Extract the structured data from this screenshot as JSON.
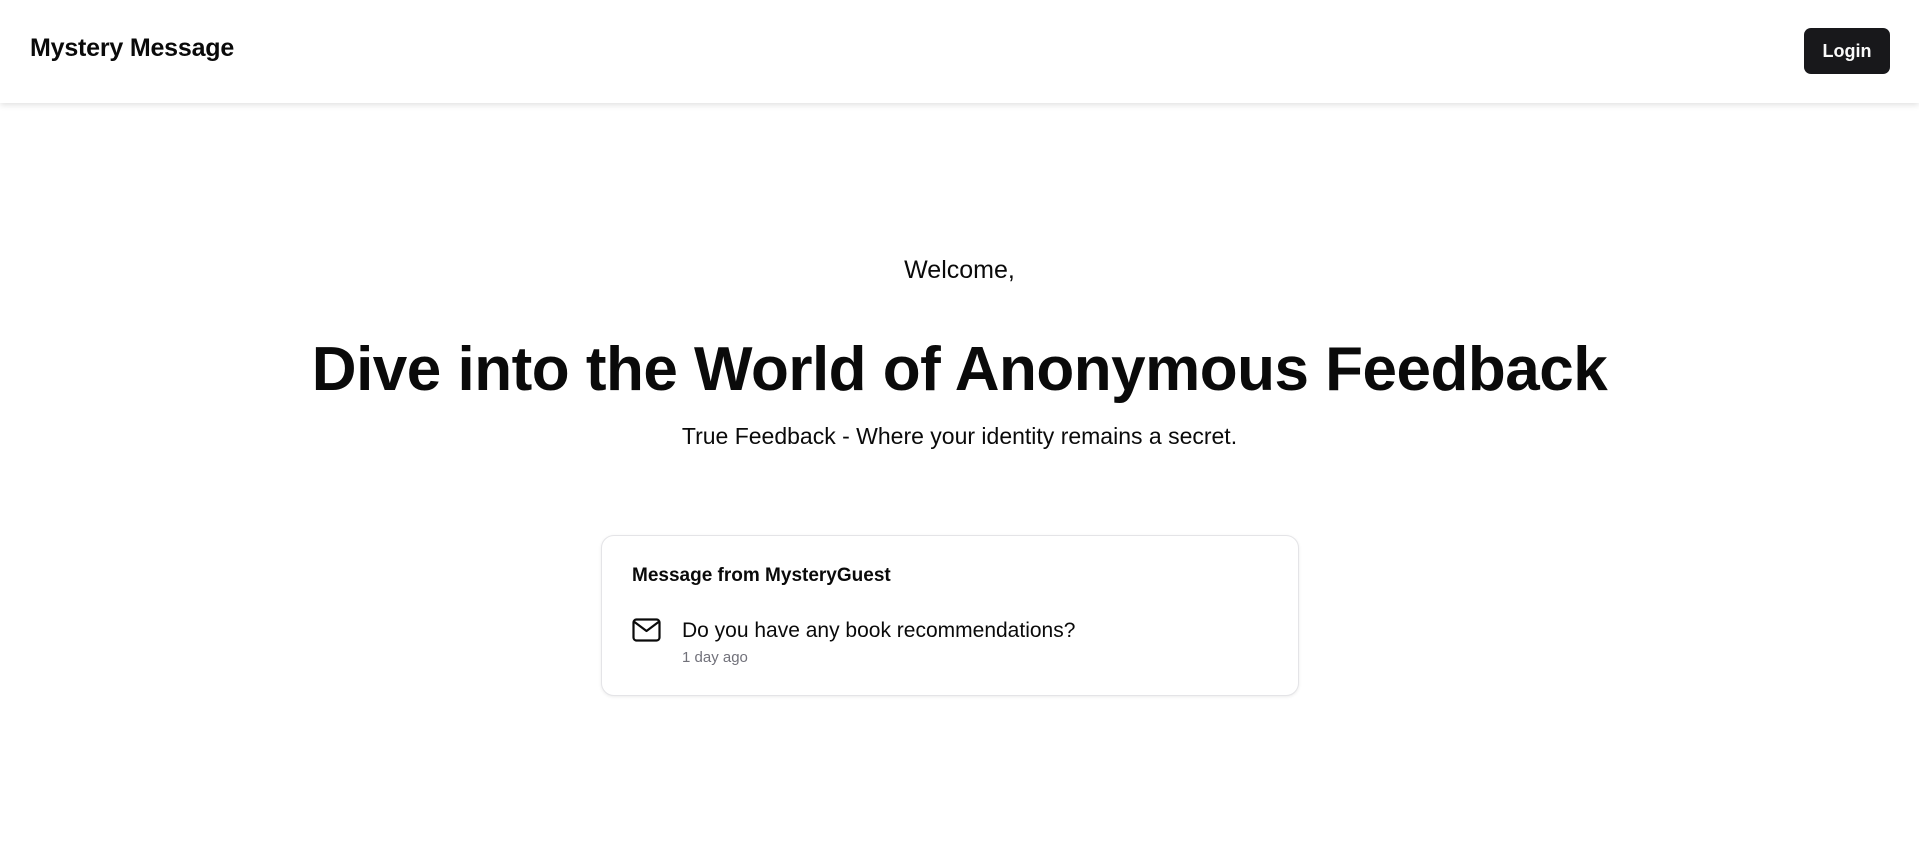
{
  "navbar": {
    "brand": "Mystery Message",
    "login_label": "Login"
  },
  "hero": {
    "welcome": "Welcome,",
    "headline": "Dive into the World of Anonymous Feedback",
    "subtitle": "True Feedback - Where your identity remains a secret."
  },
  "message_card": {
    "title": "Message from MysteryGuest",
    "icon": "mail-icon",
    "content": "Do you have any book recommendations?",
    "timestamp": "1 day ago"
  },
  "colors": {
    "primary_button": "#18181b",
    "text": "#0a0a0a",
    "muted_text": "#71717a",
    "border": "#e4e4e7"
  }
}
